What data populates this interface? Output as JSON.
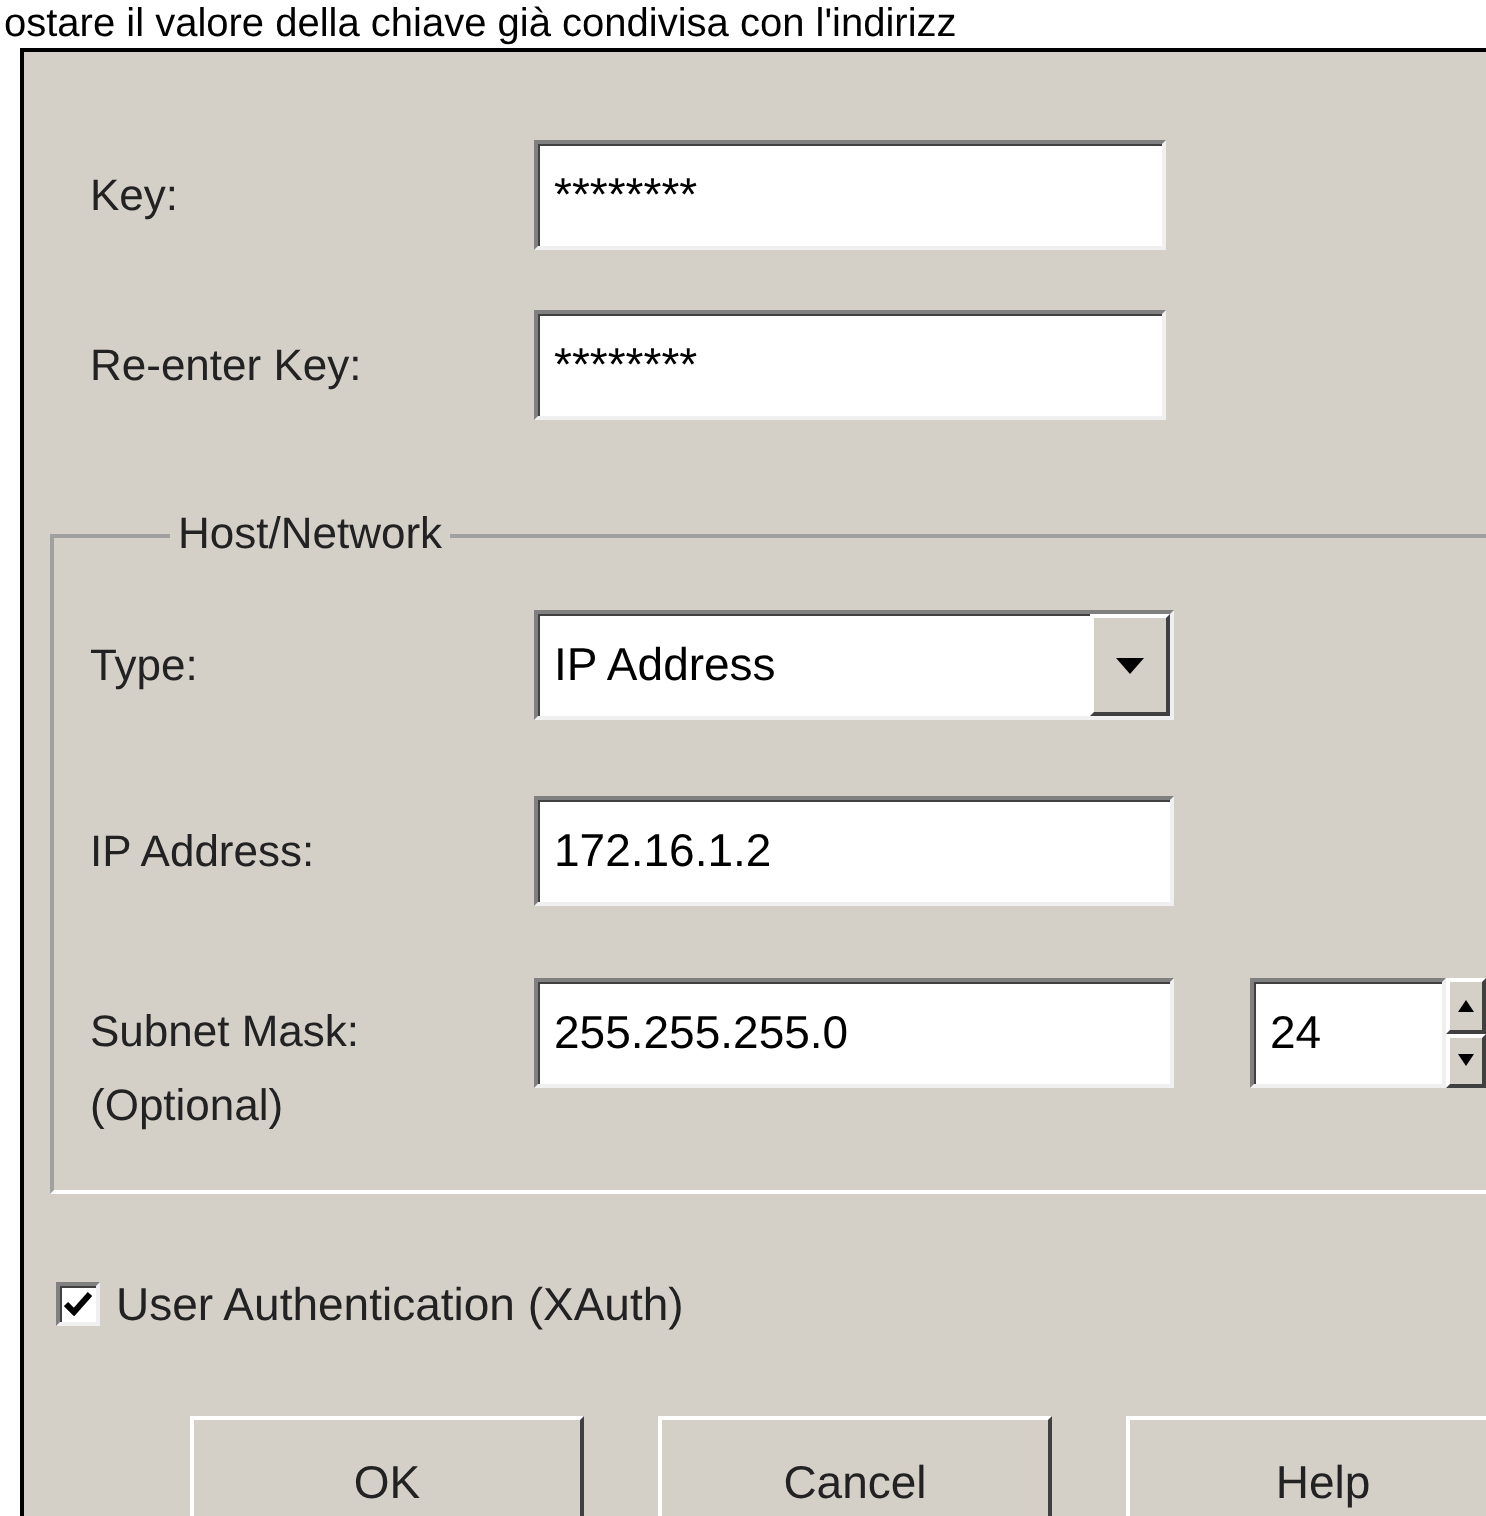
{
  "caption": "ostare il valore della chiave già condivisa con l'indirizz",
  "key_fields": [
    {
      "label": "Key:",
      "value": "********"
    },
    {
      "label": "Re-enter Key:",
      "value": "********"
    }
  ],
  "host_network": {
    "legend": "Host/Network",
    "type": {
      "label": "Type:",
      "value": "IP Address"
    },
    "ip_address": {
      "label": "IP Address:",
      "value": "172.16.1.2"
    },
    "subnet_mask": {
      "label": "Subnet Mask:",
      "note": "(Optional)",
      "value": "255.255.255.0",
      "prefix": "24"
    }
  },
  "user_authentication": {
    "label": "User Authentication (XAuth)",
    "checked": true
  },
  "buttons": [
    "OK",
    "Cancel",
    "Help"
  ]
}
